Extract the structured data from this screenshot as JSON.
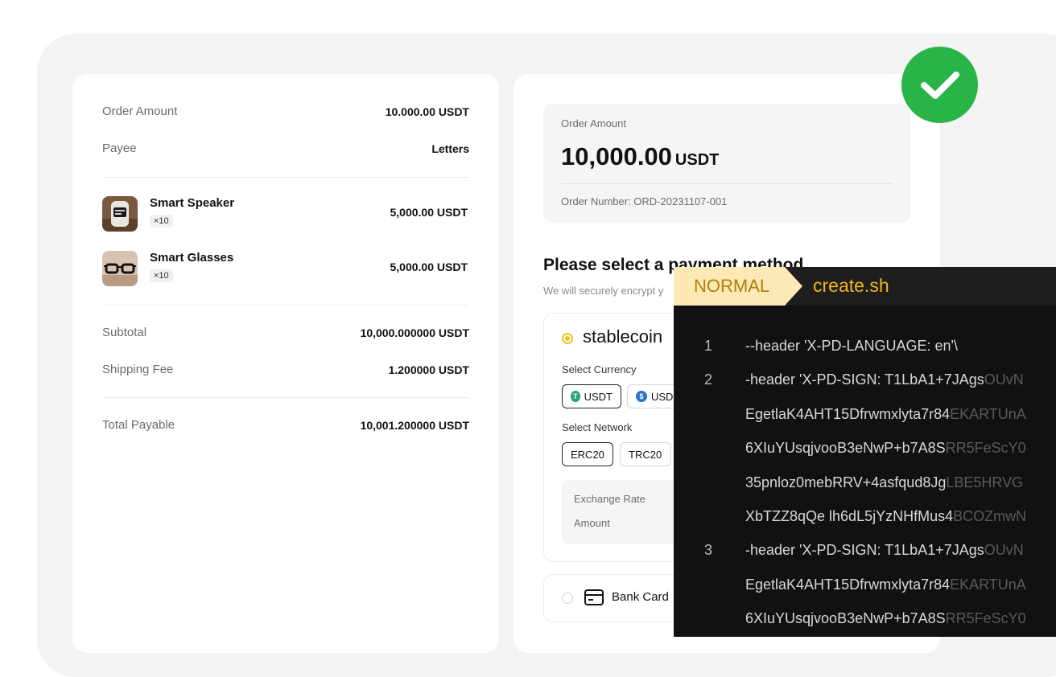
{
  "order": {
    "amount_label": "Order Amount",
    "amount_value": "10.000.00 USDT",
    "payee_label": "Payee",
    "payee_value": "Letters",
    "items": [
      {
        "name": "Smart Speaker",
        "qty": "×10",
        "price": "5,000.00 USDT"
      },
      {
        "name": "Smart Glasses",
        "qty": "×10",
        "price": "5,000.00 USDT"
      }
    ],
    "subtotal_label": "Subtotal",
    "subtotal_value": "10,000.000000 USDT",
    "shipping_label": "Shipping Fee",
    "shipping_value": "1.200000 USDT",
    "total_label": "Total Payable",
    "total_value": "10,001.200000 USDT"
  },
  "summary": {
    "label": "Order Amount",
    "amount": "10,000.00",
    "unit": "USDT",
    "order_number": "Order Number: ORD-20231107-001"
  },
  "payment": {
    "title": "Please select a payment method",
    "subtitle": "We will securely encrypt y",
    "stablecoin_label": "stablecoin",
    "currency_label": "Select Currency",
    "currencies": [
      "USDT",
      "USD"
    ],
    "network_label": "Select Network",
    "networks": [
      "ERC20",
      "TRC20"
    ],
    "exchange_rate_label": "Exchange Rate",
    "amount_label": "Amount",
    "bank_card_label": "Bank Card"
  },
  "terminal": {
    "mode": "NORMAL",
    "filename": "create.sh",
    "lines": [
      {
        "num": "1",
        "code": "--header 'X-PD-LANGUAGE: en'\\",
        "fade": ""
      },
      {
        "num": "2",
        "code": "-header 'X-PD-SIGN: T1LbA1+7JAgs",
        "fade": "OUvN"
      },
      {
        "num": "",
        "code": "EgetlaK4AHT15Dfrwmxlyta7r84",
        "fade": "EKARTUnA"
      },
      {
        "num": "",
        "code": "6XIuYUsqjvooB3eNwP+b7A8S",
        "fade": "RR5FeScY0"
      },
      {
        "num": "",
        "code": "35pnloz0mebRRV+4asfqud8Jg",
        "fade": "LBE5HRVG"
      },
      {
        "num": "",
        "code": "XbTZZ8qQe lh6dL5jYzNHfMus4",
        "fade": "BCOZmwN"
      },
      {
        "num": "3",
        "code": "-header 'X-PD-SIGN: T1LbA1+7JAgs",
        "fade": "OUvN"
      },
      {
        "num": "",
        "code": "EgetlaK4AHT15Dfrwmxlyta7r84",
        "fade": "EKARTUnA"
      },
      {
        "num": "",
        "code": "6XIuYUsqjvooB3eNwP+b7A8S",
        "fade": "RR5FeScY0"
      }
    ]
  },
  "colors": {
    "accent_yellow": "#f3c21b",
    "success_green": "#28b446",
    "terminal_bg": "#111111",
    "mode_bg": "#fce9b6",
    "filename": "#f2b51c"
  }
}
